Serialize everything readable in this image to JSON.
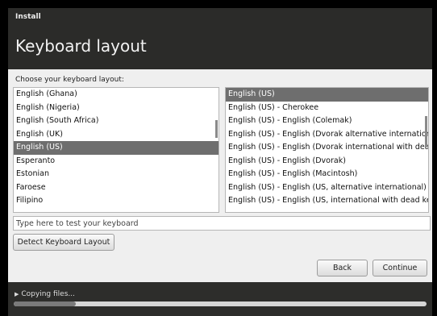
{
  "window": {
    "title": "Install"
  },
  "header": {
    "title": "Keyboard layout"
  },
  "main": {
    "prompt": "Choose your keyboard layout:",
    "layouts": [
      {
        "label": "English (Ghana)",
        "selected": false
      },
      {
        "label": "English (Nigeria)",
        "selected": false
      },
      {
        "label": "English (South Africa)",
        "selected": false
      },
      {
        "label": "English (UK)",
        "selected": false
      },
      {
        "label": "English (US)",
        "selected": true
      },
      {
        "label": "Esperanto",
        "selected": false
      },
      {
        "label": "Estonian",
        "selected": false
      },
      {
        "label": "Faroese",
        "selected": false
      },
      {
        "label": "Filipino",
        "selected": false
      }
    ],
    "variants": [
      {
        "label": "English (US)",
        "selected": true
      },
      {
        "label": "English (US) - Cherokee",
        "selected": false
      },
      {
        "label": "English (US) - English (Colemak)",
        "selected": false
      },
      {
        "label": "English (US) - English (Dvorak alternative international no dead keys)",
        "selected": false
      },
      {
        "label": "English (US) - English (Dvorak international with dead keys)",
        "selected": false
      },
      {
        "label": "English (US) - English (Dvorak)",
        "selected": false
      },
      {
        "label": "English (US) - English (Macintosh)",
        "selected": false
      },
      {
        "label": "English (US) - English (US, alternative international)",
        "selected": false
      },
      {
        "label": "English (US) - English (US, international with dead keys)",
        "selected": false
      }
    ],
    "test_input": {
      "value": "",
      "placeholder": "Type here to test your keyboard"
    },
    "detect_label": "Detect Keyboard Layout"
  },
  "nav": {
    "back_label": "Back",
    "continue_label": "Continue"
  },
  "footer": {
    "status": "Copying files...",
    "progress": 0.15
  }
}
